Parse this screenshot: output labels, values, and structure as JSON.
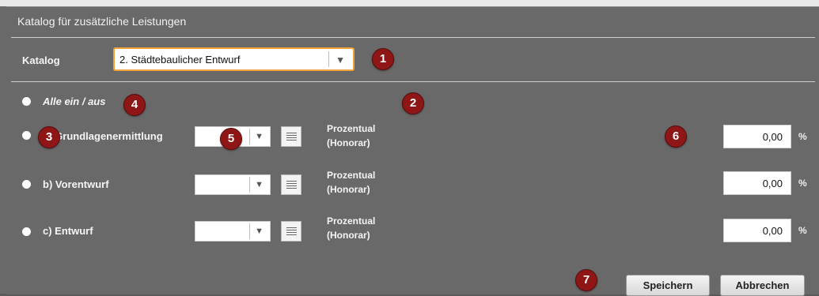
{
  "dialog": {
    "title": "Katalog für zusätzliche Leistungen"
  },
  "katalog": {
    "label": "Katalog",
    "selected": "2. Städtebaulicher Entwurf"
  },
  "toggle_all": {
    "label": "Alle ein / aus"
  },
  "items": [
    {
      "label": "a) Grundlagenermittlung",
      "type": "Prozentual\n(Honorar)",
      "type_line1": "Prozentual",
      "type_line2": "(Honorar)",
      "value": "0,00",
      "unit": "%"
    },
    {
      "label": "b) Vorentwurf",
      "type": "Prozentual\n(Honorar)",
      "type_line1": "Prozentual",
      "type_line2": "(Honorar)",
      "value": "0,00",
      "unit": "%"
    },
    {
      "label": "c) Entwurf",
      "type": "Prozentual\n(Honorar)",
      "type_line1": "Prozentual",
      "type_line2": "(Honorar)",
      "value": "0,00",
      "unit": "%"
    }
  ],
  "buttons": {
    "save": "Speichern",
    "cancel": "Abbrechen"
  },
  "callouts": [
    "1",
    "2",
    "3",
    "4",
    "5",
    "6",
    "7"
  ],
  "colors": {
    "callout": "#8e1616",
    "combo_border": "#f0a23a"
  }
}
